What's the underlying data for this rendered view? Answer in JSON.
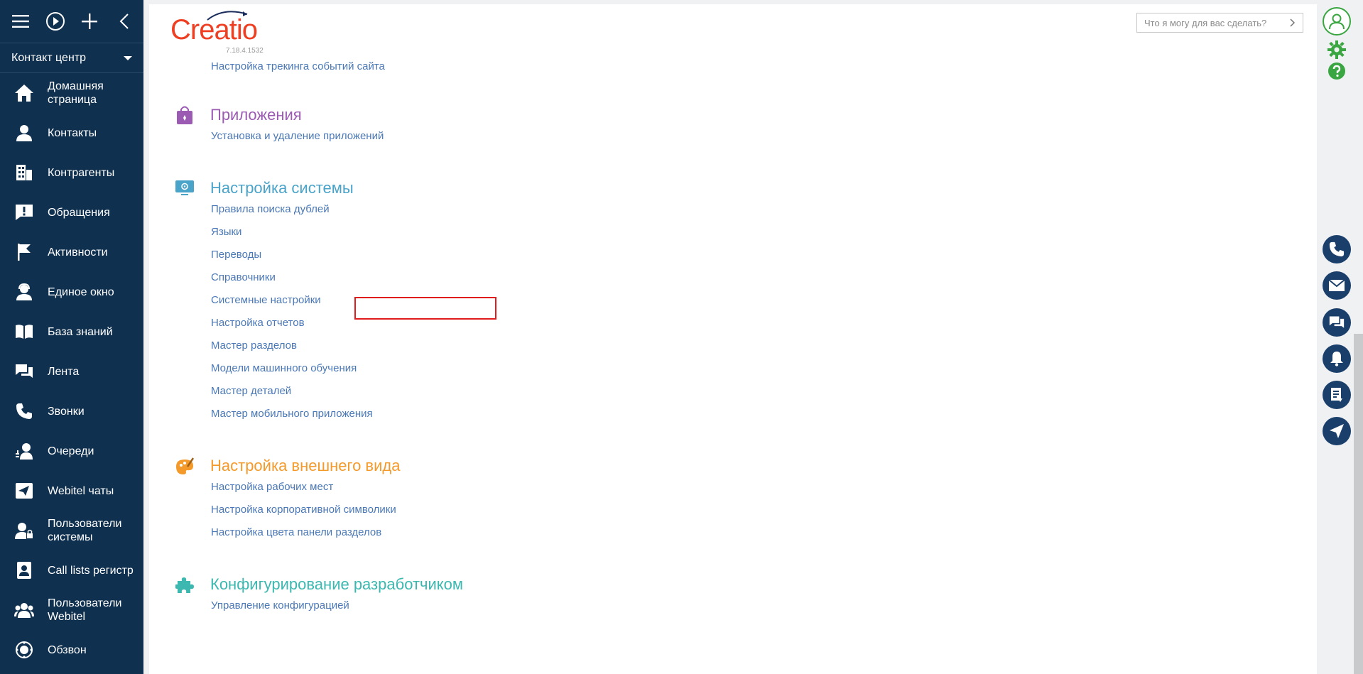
{
  "sidebar": {
    "workspace": "Контакт центр",
    "items": [
      {
        "label": "Домашняя страница",
        "icon": "home-icon"
      },
      {
        "label": "Контакты",
        "icon": "person-icon"
      },
      {
        "label": "Контрагенты",
        "icon": "building-icon"
      },
      {
        "label": "Обращения",
        "icon": "exclamation-icon"
      },
      {
        "label": "Активности",
        "icon": "flag-icon"
      },
      {
        "label": "Единое окно",
        "icon": "operator-icon"
      },
      {
        "label": "База знаний",
        "icon": "book-icon"
      },
      {
        "label": "Лента",
        "icon": "chat-icon"
      },
      {
        "label": "Звонки",
        "icon": "phone-icon"
      },
      {
        "label": "Очереди",
        "icon": "queue-icon"
      },
      {
        "label": "Webitel чаты",
        "icon": "send-icon"
      },
      {
        "label": "Пользователи системы",
        "icon": "user-lock-icon"
      },
      {
        "label": "Call lists регистр",
        "icon": "contact-list-icon"
      },
      {
        "label": "Пользователи Webitel",
        "icon": "users-icon"
      },
      {
        "label": "Обзвон",
        "icon": "dialer-icon"
      }
    ]
  },
  "header": {
    "logo_text": "Creatio",
    "version": "7.18.4.1532",
    "search_placeholder": "Что я могу для вас сделать?"
  },
  "sections": [
    {
      "title": "",
      "color": "#4a78b6",
      "links": [
        "Настройка трекинга событий сайта"
      ]
    },
    {
      "title": "Приложения",
      "color": "#9c5bb3",
      "links": [
        "Установка и удаление приложений"
      ]
    },
    {
      "title": "Настройка системы",
      "color": "#4aa3c9",
      "links": [
        "Правила поиска дублей",
        "Языки",
        "Переводы",
        "Справочники",
        "Системные настройки",
        "Настройка отчетов",
        "Мастер разделов",
        "Модели машинного обучения",
        "Мастер деталей",
        "Мастер мобильного приложения"
      ]
    },
    {
      "title": "Настройка внешнего вида",
      "color": "#f39a2b",
      "links": [
        "Настройка рабочих мест",
        "Настройка корпоративной символики",
        "Настройка цвета панели разделов"
      ]
    },
    {
      "title": "Конфигурирование разработчиком",
      "color": "#3cb8b0",
      "links": [
        "Управление конфигурацией"
      ]
    }
  ],
  "highlighted_link": "Системные настройки",
  "colors": {
    "sidebar": "#10304f",
    "accent_green": "#3aa641",
    "highlight": "#e01c1c"
  }
}
